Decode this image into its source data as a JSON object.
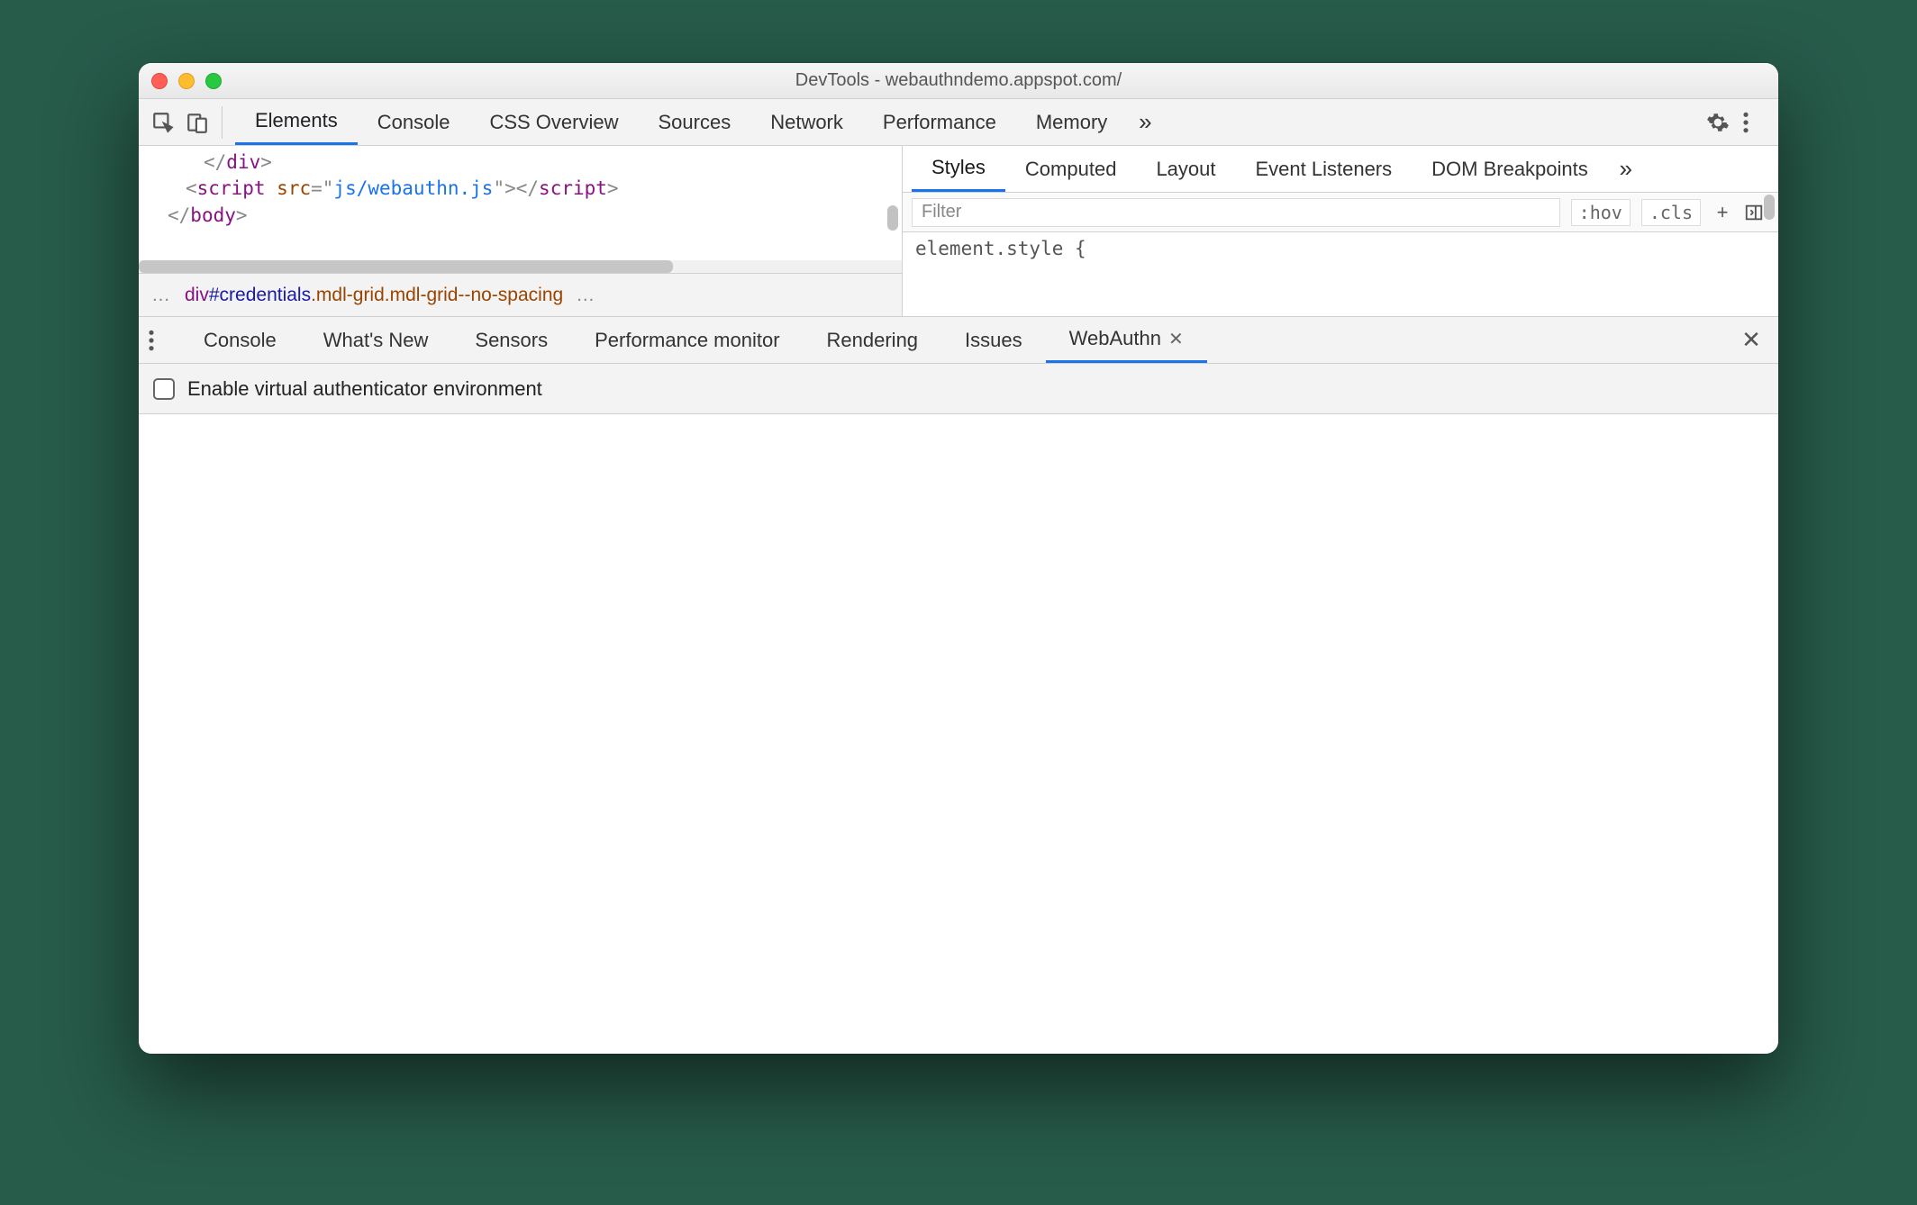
{
  "titlebar": {
    "title": "DevTools - webauthndemo.appspot.com/"
  },
  "main_tabs": {
    "items": [
      "Elements",
      "Console",
      "CSS Overview",
      "Sources",
      "Network",
      "Performance",
      "Memory"
    ],
    "overflow_glyph": "»"
  },
  "code": {
    "line1_raw": "</div>",
    "line2": {
      "t_open": "<",
      "tag": "script",
      "attr": "src",
      "eq": "=",
      "q": "\"",
      "val": "js/webauthn.js",
      "t_close": ">",
      "close_open": "</",
      "close_tag": "script",
      "close_end": ">"
    },
    "line3": {
      "open": "</",
      "tag": "body",
      "close": ">"
    }
  },
  "breadcrumb": {
    "dots": "…",
    "tag": "div",
    "id": "#credentials",
    "cls1": ".mdl-grid",
    "cls2": ".mdl-grid--no-spacing",
    "trail": "…"
  },
  "styles": {
    "tabs": [
      "Styles",
      "Computed",
      "Layout",
      "Event Listeners",
      "DOM Breakpoints"
    ],
    "overflow_glyph": "»",
    "filter_placeholder": "Filter",
    "hov": ":hov",
    "cls": ".cls",
    "plus": "+",
    "element_line": "element.style {"
  },
  "drawer": {
    "tabs": [
      "Console",
      "What's New",
      "Sensors",
      "Performance monitor",
      "Rendering",
      "Issues",
      "WebAuthn"
    ],
    "active": "WebAuthn"
  },
  "webauthn": {
    "checkbox_label": "Enable virtual authenticator environment"
  }
}
